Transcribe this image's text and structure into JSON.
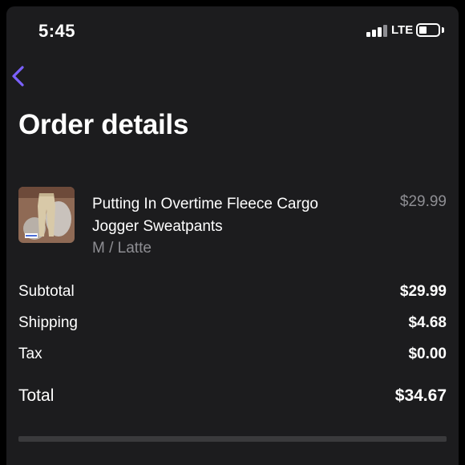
{
  "status_bar": {
    "time": "5:45",
    "network": "LTE"
  },
  "header": {
    "title": "Order details"
  },
  "order_item": {
    "name": "Putting In Overtime Fleece Cargo Jogger Sweatpants",
    "variant": "M / Latte",
    "price": "$29.99"
  },
  "summary": {
    "subtotal_label": "Subtotal",
    "subtotal_value": "$29.99",
    "shipping_label": "Shipping",
    "shipping_value": "$4.68",
    "tax_label": "Tax",
    "tax_value": "$0.00",
    "total_label": "Total",
    "total_value": "$34.67"
  },
  "colors": {
    "background": "#1c1c1e",
    "accent": "#7b61ff",
    "secondary_text": "#8e8e93"
  },
  "icons": [
    "back-chevron-icon",
    "signal-icon",
    "battery-icon"
  ]
}
